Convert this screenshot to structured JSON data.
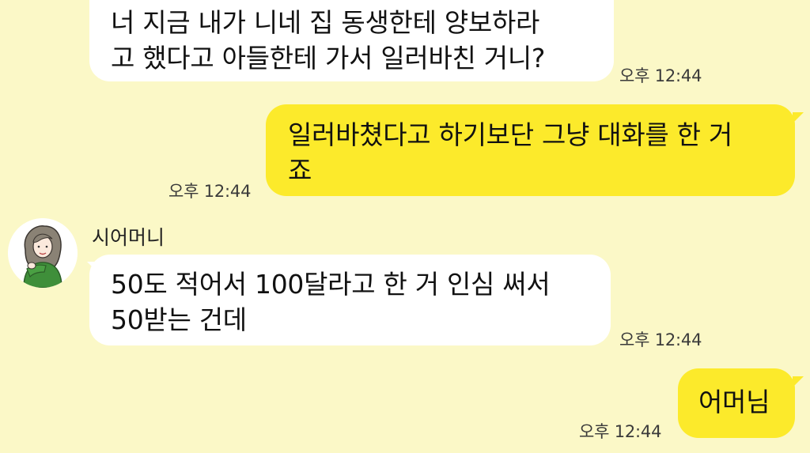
{
  "messages": [
    {
      "type": "received",
      "lines": [
        "너 지금 내가 니네 집 동생한테 양보하라",
        "고 했다고 아들한테 가서 일러바친 거니?"
      ],
      "time": "오후 12:44"
    },
    {
      "type": "sent",
      "lines": [
        "일러바쳤다고 하기보단 그냥 대화를 한 거",
        "죠"
      ],
      "time": "오후 12:44"
    },
    {
      "type": "received",
      "sender": "시어머니",
      "lines": [
        "50도 적어서 100달라고 한 거 인심 써서",
        "50받는 건데"
      ],
      "time": "오후 12:44"
    },
    {
      "type": "sent",
      "lines": [
        "어머님"
      ],
      "time": "오후 12:44"
    }
  ],
  "colors": {
    "background": "#fbf8c7",
    "received_bubble": "#ffffff",
    "sent_bubble": "#fcea2b"
  },
  "avatar_icon": "woman-illustration-avatar"
}
